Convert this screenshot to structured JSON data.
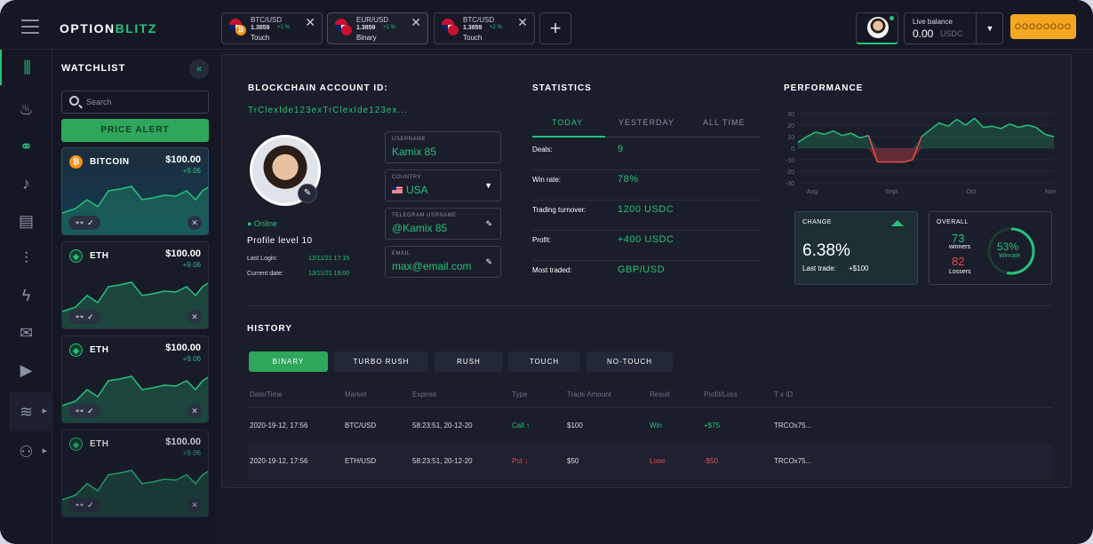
{
  "app": {
    "logo_part1": "OPTION",
    "logo_part2": "BLITZ"
  },
  "tabs": [
    {
      "pair": "BTC/USD",
      "price": "1.3859",
      "change": "+1 %",
      "kind": "Touch",
      "close": "✕"
    },
    {
      "pair": "EUR/USD",
      "price": "1.3859",
      "change": "+1 %",
      "kind": "Binary",
      "close": "✕"
    },
    {
      "pair": "BTC/USD",
      "price": "1.3859",
      "change": "+2 %",
      "kind": "Touch",
      "close": "✕"
    }
  ],
  "header": {
    "add_tab": "+",
    "balance_label": "Live balance",
    "balance_value": "0.00",
    "balance_currency": "USDC",
    "deposit_label": "OOOOOOOO",
    "dropdown_glyph": "▼"
  },
  "watchlist": {
    "title": "WATCHLIST",
    "collapse_glyph": "«",
    "search_placeholder": "Search",
    "price_alert": "PRICE ALERT",
    "items": [
      {
        "name": "BITCOIN",
        "symbol": "₿",
        "price": "$100.00",
        "change": "+9.06",
        "watch": "👓 ✓",
        "close": "✕"
      },
      {
        "name": "ETH",
        "symbol": "◆",
        "price": "$100.00",
        "change": "+9.06",
        "watch": "👓 ✓",
        "close": "✕"
      },
      {
        "name": "ETH",
        "symbol": "◆",
        "price": "$100.00",
        "change": "+9.06",
        "watch": "👓 ✓",
        "close": "✕"
      },
      {
        "name": "ETH",
        "symbol": "◆",
        "price": "$100.00",
        "change": "+9.06",
        "watch": "👓 ✓",
        "close": "✕"
      }
    ]
  },
  "sidebar_icons": [
    "chart-icon",
    "fire-icon",
    "binoculars-icon",
    "bell-icon",
    "news-icon",
    "candles-icon",
    "bolt-icon",
    "chat-icon",
    "play-icon",
    "database-icon",
    "network-icon"
  ],
  "account": {
    "section_title": "BLOCKCHAIN ACCOUNT ID:",
    "id": "TrClexIde123exTrClexIde123ex...",
    "status": "● Online",
    "profile_level": "Profile level 10",
    "last_login_label": "Last Login:",
    "last_login_value": "12/11/21 17:15",
    "current_date_label": "Current date:",
    "current_date_value": "13/11/21 19:00",
    "edit_glyph": "✎",
    "fields": [
      {
        "label": "USERNAME",
        "value": "Kamix 85"
      },
      {
        "label": "COUNTRY",
        "value": "USA"
      },
      {
        "label": "TELEGRAM USRNAME",
        "value": "@Kamix 85"
      },
      {
        "label": "EMAIL",
        "value": "max@email.com"
      }
    ]
  },
  "statistics": {
    "title": "STATISTICS",
    "tabs": [
      "TODAY",
      "YESTERDAY",
      "ALL TIME"
    ],
    "rows": [
      {
        "label": "Deals:",
        "value": "9"
      },
      {
        "label": "Win rate:",
        "value": "78%"
      },
      {
        "label": "Trading turnover:",
        "value": "1200 USDC"
      },
      {
        "label": "Profit:",
        "value": "+400 USDC"
      },
      {
        "label": "Most traded:",
        "value": "GBP/USD"
      }
    ]
  },
  "performance": {
    "title": "PERFORMANCE",
    "change_label": "CHANGE",
    "change_value": "6.38%",
    "last_trade_label": "Last trade:",
    "last_trade_value": "+$100",
    "overall_label": "OVERALL",
    "winners": "73",
    "winners_label": "winners",
    "losers": "82",
    "losers_label": "Lossers",
    "winrate": "53%",
    "winrate_label": "Winrate",
    "winrate_fraction": 0.53,
    "colors": {
      "accent": "#27c27a",
      "loss": "#e94b4b"
    }
  },
  "chart_data": {
    "type": "area",
    "title": "",
    "xlabel": "",
    "ylabel": "",
    "x_tick_labels": [
      "Aug",
      "Sept",
      "Oct",
      "Nov"
    ],
    "y_tick_labels": [
      "30",
      "20",
      "10",
      "0",
      "-10",
      "-20",
      "-30"
    ],
    "ylim": [
      -30,
      30
    ],
    "grid": true,
    "values": [
      5,
      10,
      14,
      12,
      15,
      11,
      13,
      9,
      11,
      -12,
      -12,
      -12,
      -12,
      -10,
      10,
      16,
      22,
      19,
      25,
      20,
      26,
      18,
      19,
      17,
      21,
      18,
      20,
      18,
      12,
      10
    ]
  },
  "history": {
    "title": "HISTORY",
    "filters": [
      "BINARY",
      "TURBO RUSH",
      "RUSH",
      "TOUCH",
      "NO-TOUCH"
    ],
    "columns": [
      "Date/Time",
      "Market",
      "Expired",
      "Type",
      "Trade Amount",
      "Result",
      "Profit/Loss",
      "T x ID"
    ],
    "rows": [
      [
        "2020-19-12, 17:56",
        "BTC/USD",
        "58:23:51, 20-12-20",
        "Call ↑",
        "$100",
        "Win",
        "+$75",
        "TRCOx75..."
      ],
      [
        "2020-19-12, 17:56",
        "ETH/USD",
        "58:23:51, 20-12-20",
        "Put ↓",
        "$50",
        "Lose",
        "-$50",
        "TRCOx75..."
      ]
    ]
  }
}
